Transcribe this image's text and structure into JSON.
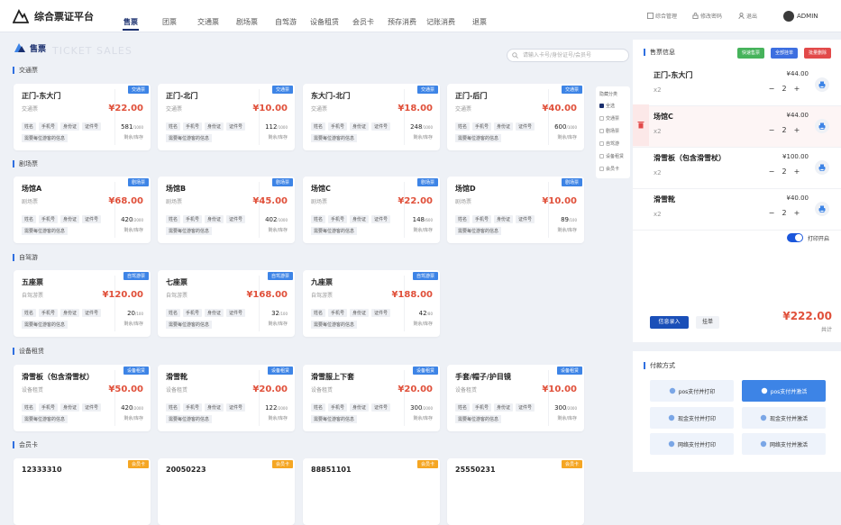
{
  "app": {
    "title": "综合票证平台",
    "user": "ADMIN"
  },
  "nav": [
    "售票",
    "团票",
    "交通票",
    "剧场票",
    "自驾游",
    "设备租赁",
    "会员卡",
    "预存消费",
    "记账消费",
    "退票"
  ],
  "topright": {
    "ops": "综合管理",
    "password": "修改密码",
    "logout": "退出"
  },
  "section": {
    "title": "售票",
    "watermark": "TICKET SALES",
    "search_placeholder": "请输入卡号/身份证号/会员号"
  },
  "filters": [
    "隐藏分类",
    "全选",
    "交通票",
    "剧场票",
    "自驾游",
    "设备租赁",
    "会员卡"
  ],
  "categories": [
    {
      "name": "交通票",
      "items": [
        {
          "name": "正门-东大门",
          "sub": "交通票",
          "price": "¥22.00",
          "tag": "交通票",
          "stock": "581",
          "total": "/1000"
        },
        {
          "name": "正门-北门",
          "sub": "交通票",
          "price": "¥10.00",
          "tag": "交通票",
          "stock": "112",
          "total": "/1000"
        },
        {
          "name": "东大门-北门",
          "sub": "交通票",
          "price": "¥18.00",
          "tag": "交通票",
          "stock": "248",
          "total": "/1000"
        },
        {
          "name": "正门-后门",
          "sub": "交通票",
          "price": "¥40.00",
          "tag": "交通票",
          "stock": "600",
          "total": "/1000"
        }
      ]
    },
    {
      "name": "剧场票",
      "items": [
        {
          "name": "场馆A",
          "sub": "剧场票",
          "price": "¥68.00",
          "tag": "剧场票",
          "stock": "420",
          "total": "/2000"
        },
        {
          "name": "场馆B",
          "sub": "剧场票",
          "price": "¥45.00",
          "tag": "剧场票",
          "stock": "402",
          "total": "/1000"
        },
        {
          "name": "场馆C",
          "sub": "剧场票",
          "price": "¥22.00",
          "tag": "剧场票",
          "stock": "148",
          "total": "/600"
        },
        {
          "name": "场馆D",
          "sub": "剧场票",
          "price": "¥10.00",
          "tag": "剧场票",
          "stock": "89",
          "total": "/100"
        }
      ]
    },
    {
      "name": "自驾游",
      "items": [
        {
          "name": "五座票",
          "sub": "自驾游票",
          "price": "¥120.00",
          "tag": "自驾游票",
          "stock": "20",
          "total": "/100"
        },
        {
          "name": "七座票",
          "sub": "自驾游票",
          "price": "¥168.00",
          "tag": "自驾游票",
          "stock": "32",
          "total": "/100"
        },
        {
          "name": "九座票",
          "sub": "自驾游票",
          "price": "¥188.00",
          "tag": "自驾游票",
          "stock": "42",
          "total": "/80"
        }
      ]
    },
    {
      "name": "设备租赁",
      "items": [
        {
          "name": "滑雪板（包含滑雪杖）",
          "sub": "设备租赁",
          "price": "¥50.00",
          "tag": "设备租赁",
          "stock": "420",
          "total": "/2000"
        },
        {
          "name": "滑雪靴",
          "sub": "设备租赁",
          "price": "¥20.00",
          "tag": "设备租赁",
          "stock": "122",
          "total": "/2000"
        },
        {
          "name": "滑雪服上下套",
          "sub": "设备租赁",
          "price": "¥20.00",
          "tag": "设备租赁",
          "stock": "300",
          "total": "/2000"
        },
        {
          "name": "手套/帽子/护目镜",
          "sub": "设备租赁",
          "price": "¥10.00",
          "tag": "设备租赁",
          "stock": "300",
          "total": "/2000"
        }
      ]
    },
    {
      "name": "会员卡",
      "items": [
        {
          "name": "12333310",
          "tag": "会员卡"
        },
        {
          "name": "20050223",
          "tag": "会员卡"
        },
        {
          "name": "88851101",
          "tag": "会员卡"
        },
        {
          "name": "25550231",
          "tag": "会员卡"
        }
      ]
    }
  ],
  "card_labels": {
    "chips": [
      "姓名",
      "手机号",
      "身份证",
      "证件号"
    ],
    "note": "需要每位游客的信息",
    "stock_label": "剩余/库存"
  },
  "order": {
    "title": "售票信息",
    "btn_quick": "快速售票",
    "btn_clear": "全部挂单",
    "btn_cancel": "批量删除",
    "items": [
      {
        "name": "正门-东大门",
        "price": "¥44.00",
        "qty": "x2",
        "count": "2"
      },
      {
        "name": "场馆C",
        "price": "¥44.00",
        "qty": "x2",
        "count": "2"
      },
      {
        "name": "滑雪板（包含滑雪杖）",
        "price": "¥100.00",
        "qty": "x2",
        "count": "2"
      },
      {
        "name": "滑雪靴",
        "price": "¥40.00",
        "qty": "x2",
        "count": "2"
      }
    ],
    "print_toggle": "打印开启",
    "info_btn": "信息录入",
    "hold_btn": "挂单",
    "total": "¥222.00",
    "total_label": "共计"
  },
  "payment": {
    "title": "付款方式",
    "buttons": [
      "pos支付并打印",
      "pos支付并激活",
      "现金支付并打印",
      "现金支付并激活",
      "网络支付并打印",
      "网络支付并激活"
    ]
  },
  "colors": {
    "accent": "#1a2f6e",
    "primary": "#3d84e6",
    "price": "#e0503a",
    "quick": "#46b35b",
    "clear": "#3d6fe0",
    "cancel": "#e24a4a",
    "member": "#f5a623"
  }
}
